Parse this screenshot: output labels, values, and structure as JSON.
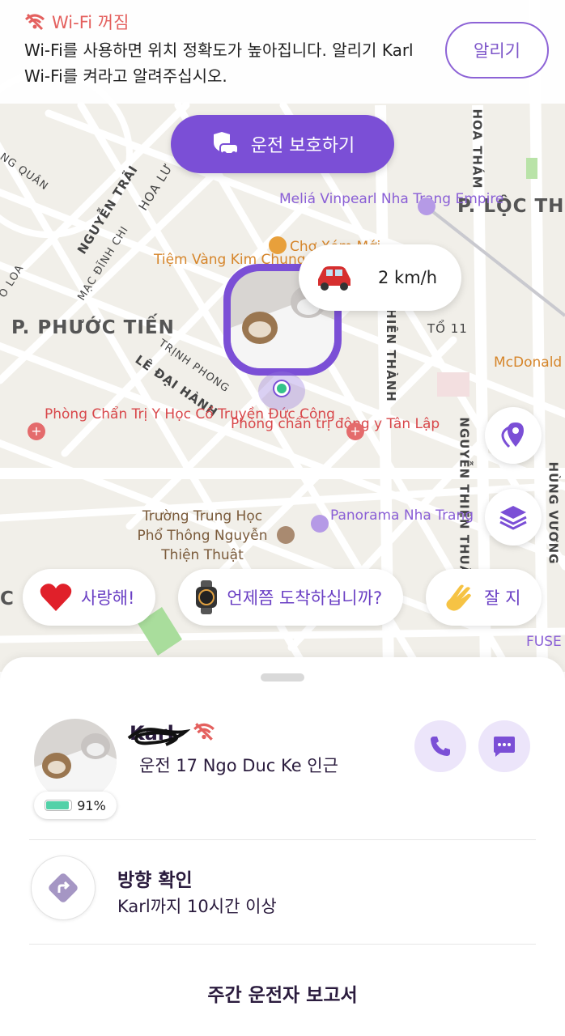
{
  "wifi_banner": {
    "title": "Wi-Fi 꺼짐",
    "message": "Wi-Fi를 사용하면 위치 정확도가 높아집니다. 알리기 Karl Wi-Fi를 켜라고 알려주십시오.",
    "notify_label": "알리기"
  },
  "drive_protect": {
    "label": "운전 보호하기"
  },
  "map": {
    "districts": [
      "P. PHƯỚC TIẾN",
      "P. LỘC THỌ"
    ],
    "streets": [
      "NGUYỄN TRÃI",
      "HOA LƯ",
      "MẠC ĐĨNH CHI",
      "TRỊNH PHONG",
      "LÊ ĐẠI HÀNH",
      "NG QUÂN",
      "O LOA",
      "HOA THÁM",
      "HIÊN THÀNH",
      "NGUYỄN THIỆN THUẬT",
      "HÙNG VƯƠNG",
      "TỔ 11"
    ],
    "pois": {
      "melia": "Meliá Vinpearl Nha Trang Empire",
      "cho": "Chợ Xóm Mới",
      "tiem_vang": "Tiệm Vàng Kim Chung",
      "mcdonalds": "McDonald",
      "phong_chan_tri_1": "Phòng Chẩn Trị Y Học Cổ Truyền Đức Công",
      "phong_chan_tri_2": "Phòng chẩn trị đông y Tân Lập",
      "truong": "Trường Trung Học Phổ Thông Nguyễn Thiện Thuật",
      "panorama": "Panorama Nha Trang",
      "fuse": "FUSE",
      "left_edge": "C H"
    },
    "speed": "2 km/h"
  },
  "chips": [
    {
      "label": "사랑해!"
    },
    {
      "label": "언제쯤 도착하십니까?"
    },
    {
      "label": "잘 지"
    }
  ],
  "member": {
    "name": "Karl",
    "status": "운전 17 Ngo Duc Ke 인근",
    "battery_text": "91%",
    "battery_level": 0.91
  },
  "directions": {
    "title": "방향 확인",
    "subtitle": "Karl까지 10시간 이상"
  },
  "weekly_report": {
    "label": "주간 운전자 보고서"
  },
  "colors": {
    "accent": "#7b4fd6",
    "wifi_off": "#e4605e",
    "battery": "#52d1a8"
  }
}
